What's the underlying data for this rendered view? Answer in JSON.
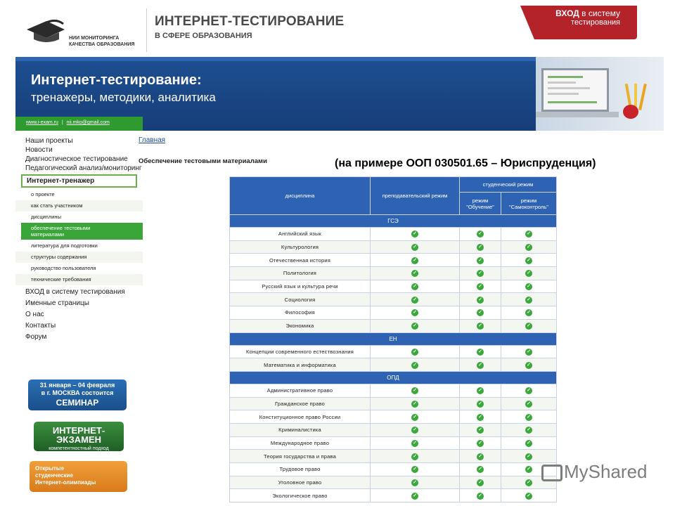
{
  "header": {
    "logo_text_line1": "НИИ МОНИТОРИНГА",
    "logo_text_line2": "КАЧЕСТВА ОБРАЗОВАНИЯ",
    "title": "ИНТЕРНЕТ-ТЕСТИРОВАНИЕ",
    "subtitle": "В СФЕРЕ ОБРАЗОВАНИЯ",
    "login_bold": "ВХОД",
    "login_rest": "в систему",
    "login_line2": "тестирования"
  },
  "banner": {
    "title": "Интернет-тестирование:",
    "subtitle": "тренажеры, методики, аналитика"
  },
  "contacts": {
    "site": "www.i-exam.ru",
    "email": "nii.mko@gmail.com"
  },
  "sidebar": {
    "items": [
      {
        "label": "Наши проекты"
      },
      {
        "label": "Новости"
      },
      {
        "label": "Диагностическое тестирование"
      },
      {
        "label": "Педагогический анализ/мониторинг"
      },
      {
        "label": "Интернет-тренажер"
      }
    ],
    "sub_items": [
      {
        "label": "о проекте"
      },
      {
        "label": "как стать участником"
      },
      {
        "label": "дисциплины"
      },
      {
        "label": "обеспечение тестовыми материалами"
      },
      {
        "label": "литература для подготовки"
      },
      {
        "label": "структуры содержания"
      },
      {
        "label": "руководство пользователя"
      },
      {
        "label": "технические требования"
      }
    ],
    "items_after": [
      {
        "label": "ВХОД в систему тестирования"
      },
      {
        "label": "Именные страницы"
      },
      {
        "label": "О нас"
      },
      {
        "label": "Контакты"
      },
      {
        "label": "Форум"
      }
    ]
  },
  "promos": {
    "seminar_line1": "31 января – 04 февраля",
    "seminar_line2": "в г. МОСКВА состоится",
    "seminar_big": "СЕМИНАР",
    "exam_title": "ИНТЕРНЕТ-ЭКЗАМЕН",
    "exam_sub": "компетентностный подход",
    "olymp_line1": "Открытые",
    "olymp_line2": "студенческие",
    "olymp_line3": "Интернет-олимпиады"
  },
  "content": {
    "breadcrumb": "Главная",
    "heading": "Обеспечение тестовыми материалами",
    "caption": "(на примере ООП 030501.65 – Юриспруденция)"
  },
  "table": {
    "col_discipline": "дисциплина",
    "col_teacher": "преподавательский режим",
    "col_student": "студенческий режим",
    "col_learn": "режим \"Обучение\"",
    "col_self": "режим \"Самоконтроль\"",
    "check_glyph": "✓",
    "sections": [
      {
        "name": "ГСЭ",
        "rows": [
          "Английский язык",
          "Культурология",
          "Отечественная история",
          "Политология",
          "Русский язык и культура речи",
          "Социология",
          "Философия",
          "Экономика"
        ]
      },
      {
        "name": "ЕН",
        "rows": [
          "Концепции современного естествознания",
          "Математика и информатика"
        ]
      },
      {
        "name": "ОПД",
        "rows": [
          "Административное право",
          "Гражданское право",
          "Конституционное право России",
          "Криминалистика",
          "Международное право",
          "Теория государства и права",
          "Трудовое право",
          "Уголовное право",
          "Экологическое право"
        ]
      }
    ]
  },
  "watermark": {
    "text": "MyShared"
  }
}
